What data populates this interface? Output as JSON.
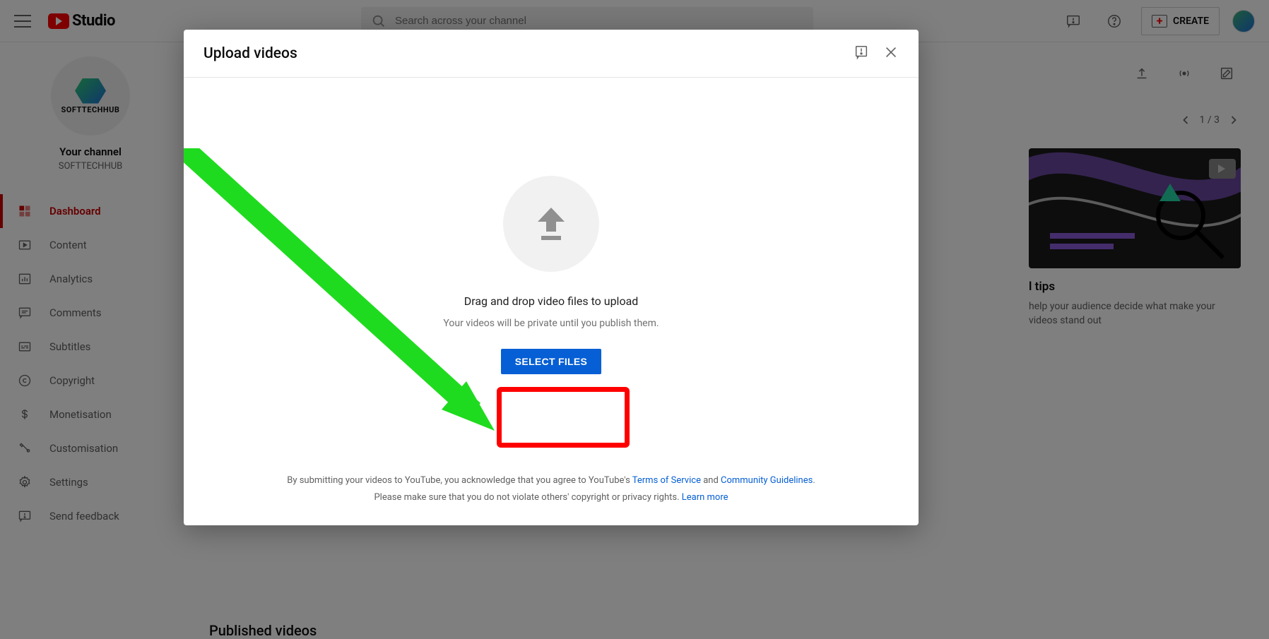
{
  "header": {
    "logo_text": "Studio",
    "search_placeholder": "Search across your channel",
    "create_label": "CREATE"
  },
  "sidebar": {
    "your_channel_label": "Your channel",
    "channel_name": "SOFTTECHHUB",
    "avatar_text": "SOFTTECHHUB",
    "items": [
      {
        "label": "Dashboard"
      },
      {
        "label": "Content"
      },
      {
        "label": "Analytics"
      },
      {
        "label": "Comments"
      },
      {
        "label": "Subtitles"
      },
      {
        "label": "Copyright"
      },
      {
        "label": "Monetisation"
      },
      {
        "label": "Customisation"
      },
      {
        "label": "Settings"
      },
      {
        "label": "Send feedback"
      }
    ]
  },
  "main": {
    "pager": "1 / 3",
    "tips_title_suffix": "l tips",
    "tips_desc": "help your audience decide what make your videos stand out",
    "published_heading": "Published videos"
  },
  "modal": {
    "title": "Upload videos",
    "drag_title": "Drag and drop video files to upload",
    "drag_sub": "Your videos will be private until you publish them.",
    "select_label": "SELECT FILES",
    "legal_prefix": "By submitting your videos to YouTube, you acknowledge that you agree to YouTube's ",
    "terms_label": "Terms of Service",
    "and": " and ",
    "guidelines_label": "Community Guidelines",
    "legal_line2_prefix": "Please make sure that you do not violate others' copyright or privacy rights. ",
    "learn_more": "Learn more"
  }
}
